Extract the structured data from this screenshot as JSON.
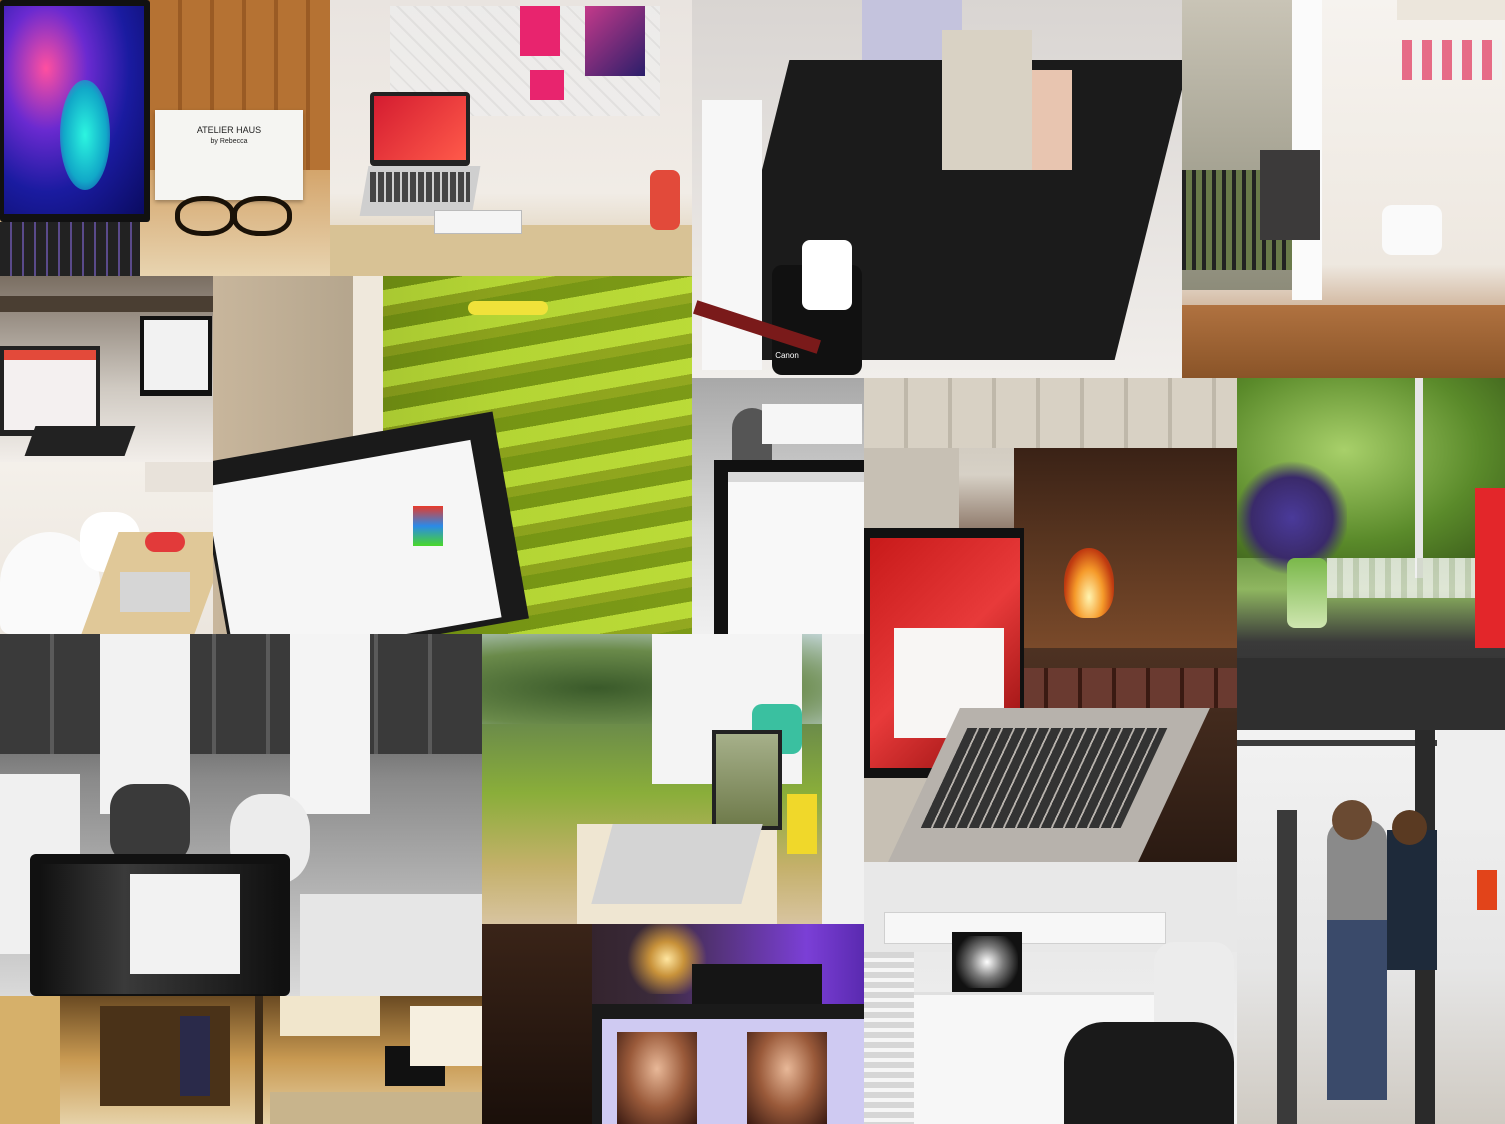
{
  "description_tiles": [
    "desk-with-laptop-and-glasses",
    "bedroom-desk-with-pink-laptop",
    "black-book-and-camera",
    "white-room-with-window",
    "office-computers",
    "train-window-laptop",
    "white-desk-room",
    "small-monitor-desk",
    "fireplace-laptop",
    "flowers-by-window",
    "black-and-white-workspace",
    "garden-laptop",
    "bright-white-office",
    "photo-studio",
    "warm-workshop",
    "purple-room-monitor"
  ],
  "card": {
    "line1": "ATELIER HAUS",
    "line2": "by Rebecca"
  },
  "camera": {
    "brand": "Canon"
  },
  "colors": {
    "pink_accent": "#e8246e",
    "fire": "#f59a2a",
    "green": "#9ec02e",
    "purple": "#7b3fd6"
  }
}
